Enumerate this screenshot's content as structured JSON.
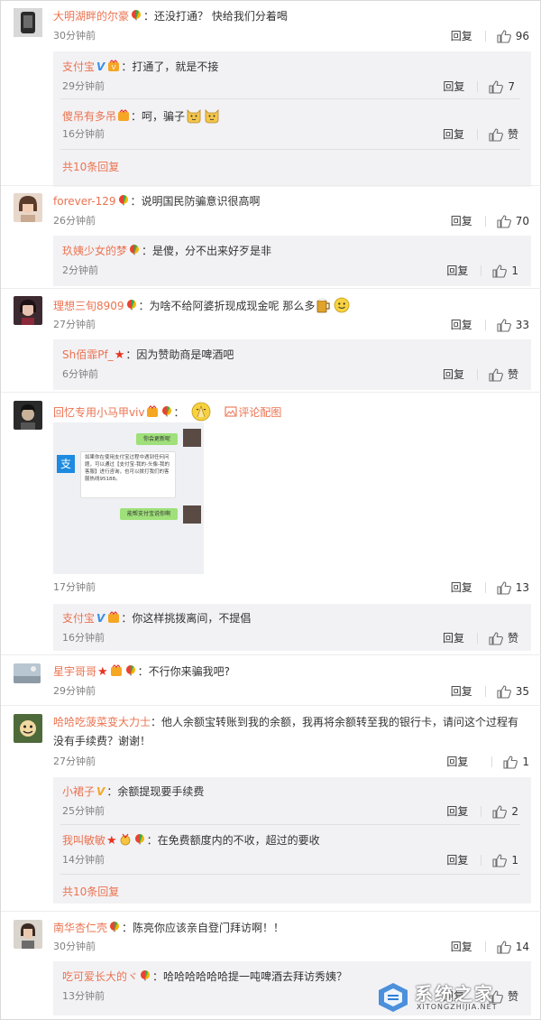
{
  "labels": {
    "reply": "回复",
    "like": "赞",
    "more_prefix": "共",
    "more_suffix": "条回复"
  },
  "c1": {
    "user": "大明湖畔的尔豪",
    "text": "：还没打通？ 快给我们分着喝",
    "time": "30分钟前",
    "likes": "96",
    "replies": [
      {
        "user": "支付宝",
        "text": "：打通了，就是不接",
        "time": "29分钟前",
        "likes": "7"
      },
      {
        "user": "傻吊有多吊",
        "text": "：呵，骗子",
        "time": "16分钟前",
        "likes": "赞"
      }
    ],
    "more_count": "10"
  },
  "c2": {
    "user": "forever-129",
    "text": "：说明国民防骗意识很高啊",
    "time": "26分钟前",
    "likes": "70",
    "replies": [
      {
        "user": "玖姨少女的梦",
        "text": "：是傻，分不出来好歹是非",
        "time": "2分钟前",
        "likes": "1"
      }
    ]
  },
  "c3": {
    "user": "理想三旬8909",
    "text": "：为啥不给阿婆折现成现金呢  那么多",
    "time": "27分钟前",
    "likes": "33",
    "replies": [
      {
        "user": "Sh佰霏Pf_",
        "text": "：因为赞助商是啤酒吧",
        "time": "6分钟前",
        "likes": "赞"
      }
    ]
  },
  "c4": {
    "user": "回忆专用小马甲viv",
    "text": "：",
    "action": "评论配图",
    "time": "17分钟前",
    "likes": "13",
    "img": {
      "bubble1": "你会更新呢",
      "bubble2": "如果你在使用支付宝过程中遇到任何问题，可以通过【支付宝-我的-头像-我的客服】进行咨询，也可以拨打我们的客服热线95188。",
      "bubble3": "能帮支付宝说你啊"
    },
    "replies": [
      {
        "user": "支付宝",
        "text": "：你这样挑拨离间，不提倡",
        "time": "16分钟前",
        "likes": "赞"
      }
    ]
  },
  "c5": {
    "user": "星宇哥哥",
    "text": "：不行你来骗我吧?",
    "time": "29分钟前",
    "likes": "35"
  },
  "c6": {
    "user": "哈哈吃菠菜变大力士",
    "text": "：他人余额宝转账到我的余额，我再将余额转至我的银行卡，请问这个过程有",
    "text2": "没有手续费？谢谢！",
    "time": "27分钟前",
    "likes": "1",
    "replies": [
      {
        "user": "小裙子",
        "text": "：余额提现要手续费",
        "time": "25分钟前",
        "likes": "2"
      },
      {
        "user": "我叫敏敏",
        "text": "：在免费额度内的不收，超过的要收",
        "time": "14分钟前",
        "likes": "1"
      }
    ],
    "more_count": "10"
  },
  "c7": {
    "user": "南华杏仁壳",
    "text": "：陈亮你应该亲自登门拜访啊！！",
    "time": "30分钟前",
    "likes": "14",
    "replies": [
      {
        "user": "吃可爱长大的ヾ",
        "text": "：哈哈哈哈哈哈提一吨啤酒去拜访秀姨？",
        "time": "13分钟前",
        "likes": "赞"
      }
    ]
  },
  "watermark": {
    "title": "系统之家",
    "sub": "XITONGZHIJIA.NET"
  },
  "colors": {
    "username": "#eb7350",
    "subbg": "#f2f2f5",
    "time": "#808080",
    "vip_blue": "#3a8ee6",
    "vip_gold": "#f5a623"
  }
}
